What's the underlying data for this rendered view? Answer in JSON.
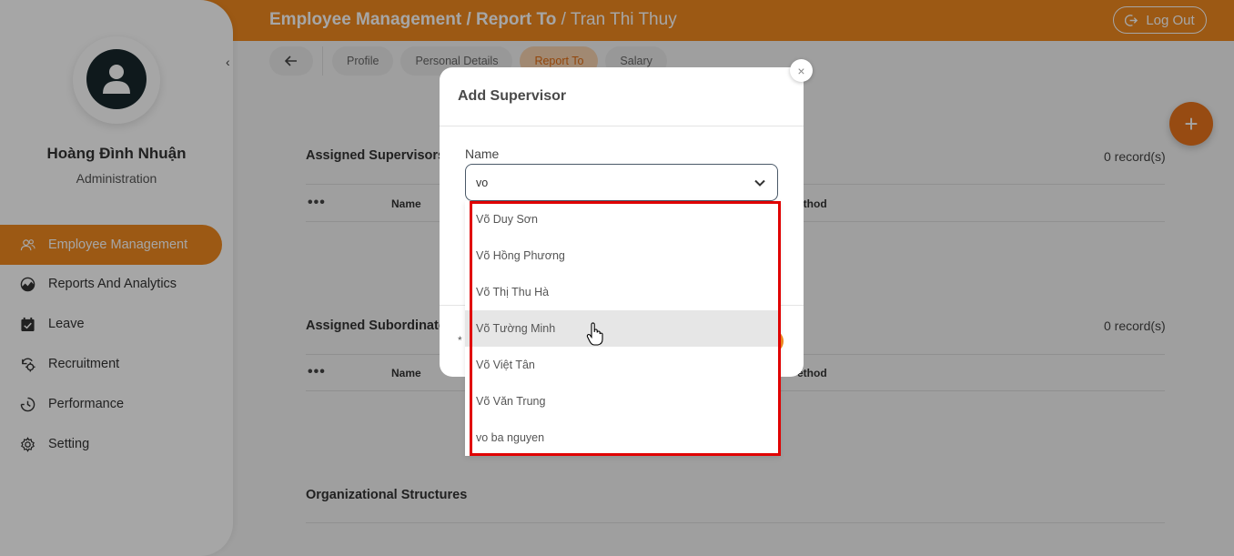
{
  "header": {
    "breadcrumb_part1": "Employee Management",
    "breadcrumb_sep1": " / ",
    "breadcrumb_part2": "Report To",
    "breadcrumb_sep2": " / ",
    "breadcrumb_part3": "Tran Thi Thuy",
    "logout_label": "Log Out"
  },
  "sidebar": {
    "user_name": "Hoàng Đình Nhuận",
    "user_role": "Administration",
    "collapse_glyph": "‹",
    "items": [
      {
        "label": "Employee Management",
        "icon": "users-icon",
        "active": true
      },
      {
        "label": "Reports And Analytics",
        "icon": "chart-icon"
      },
      {
        "label": "Leave",
        "icon": "calendar-check-icon"
      },
      {
        "label": "Recruitment",
        "icon": "recruitment-icon"
      },
      {
        "label": "Performance",
        "icon": "performance-icon"
      },
      {
        "label": "Setting",
        "icon": "gear-icon"
      }
    ]
  },
  "tabs": [
    "Profile",
    "Personal Details",
    "Report To",
    "Salary"
  ],
  "active_tab": "Report To",
  "sections": {
    "supervisors": {
      "title": "Assigned Supervisors",
      "records": "0 record(s)",
      "col_name": "Name",
      "col_method": "ethod"
    },
    "subordinates": {
      "title": "Assigned Subordinates",
      "records": "0 record(s)",
      "col_name": "Name",
      "col_method": "ethod"
    },
    "org": {
      "title": "Organizational Structures"
    }
  },
  "fab_label": "+",
  "dots": "•••",
  "modal": {
    "title": "Add Supervisor",
    "close_glyph": "×",
    "field_label": "Name",
    "field_value": "vo",
    "required_mark": "*"
  },
  "dropdown": {
    "options": [
      "Võ Duy Sơn",
      "Võ Hồng Phương",
      "Võ Thị Thu Hà",
      "Võ Tường Minh",
      "Võ Việt Tân",
      "Võ Văn Trung",
      "vo ba nguyen"
    ],
    "hovered": "Võ Tường Minh"
  },
  "colors": {
    "accent": "#f0891f",
    "highlight": "#e00000"
  }
}
